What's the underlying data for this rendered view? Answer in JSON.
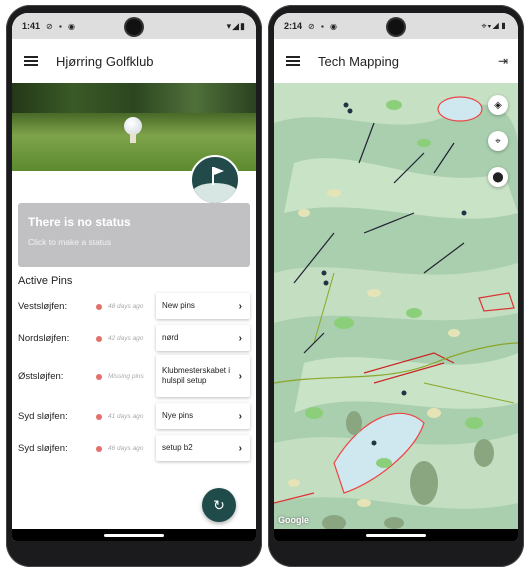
{
  "left_phone": {
    "status_time": "1:41",
    "app_title": "Hjørring Golfklub",
    "status_card": {
      "heading": "There is no status",
      "subtext": "Click to make a status"
    },
    "pins_heading": "Active Pins",
    "pins": [
      {
        "name": "Vestsløjfen:",
        "age": "48 days ago",
        "button": "New pins"
      },
      {
        "name": "Nordsløjfen:",
        "age": "42 days ago",
        "button": "nørd"
      },
      {
        "name": "Østsløjfen:",
        "age": "Missing pins",
        "button": "Klubmesterskabet i hulspil setup"
      },
      {
        "name": "Syd sløjfen:",
        "age": "41 days ago",
        "button": "Nye pins"
      },
      {
        "name": "Syd sløjfen:",
        "age": "46 days ago",
        "button": "setup b2"
      }
    ],
    "status_color": "#e2706a",
    "accent": "#1f4b4b"
  },
  "right_phone": {
    "status_time": "2:14",
    "app_title": "Tech Mapping",
    "map_attribution": "Google",
    "map_buttons": [
      "layers-icon",
      "crosshair-icon",
      "location-pin-icon"
    ],
    "exit_icon": "logout-icon"
  }
}
